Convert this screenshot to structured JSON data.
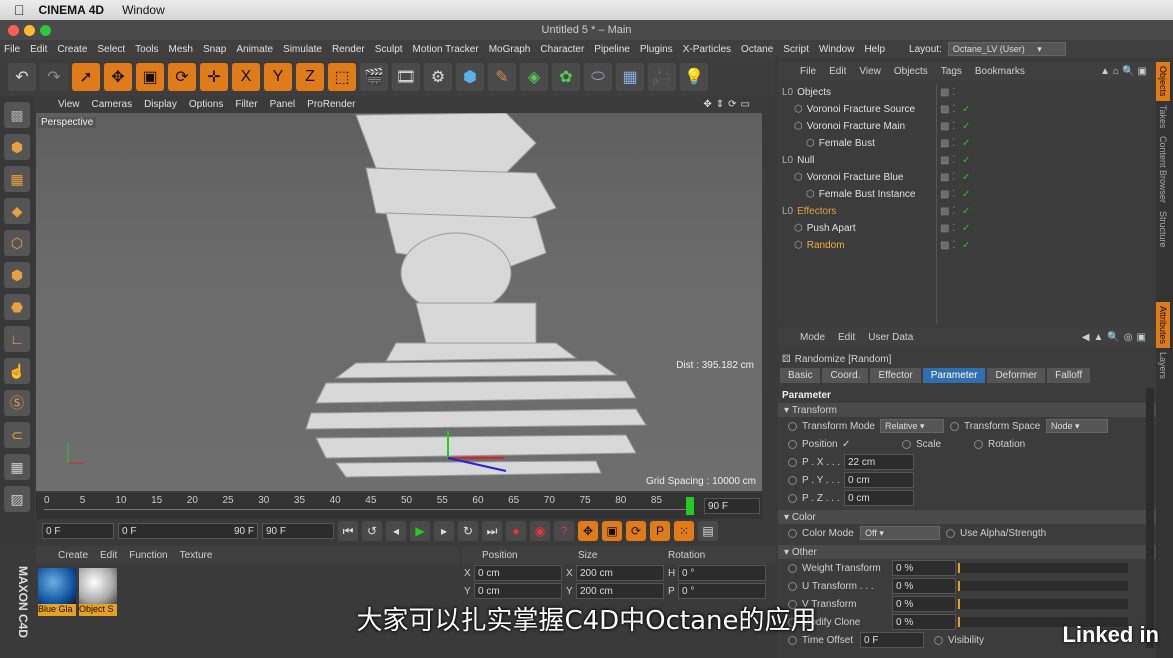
{
  "mac_menu": {
    "app": "CINEMA 4D",
    "window": "Window"
  },
  "window_title": "Untitled 5 * – Main",
  "main_menu": [
    "File",
    "Edit",
    "Create",
    "Select",
    "Tools",
    "Mesh",
    "Snap",
    "Animate",
    "Simulate",
    "Render",
    "Sculpt",
    "Motion Tracker",
    "MoGraph",
    "Character",
    "Pipeline",
    "Plugins",
    "X-Particles",
    "Octane",
    "Script",
    "Window",
    "Help"
  ],
  "layout": {
    "label": "Layout:",
    "value": "Octane_LV (User)"
  },
  "toolbar_axes": [
    "X",
    "Y",
    "Z"
  ],
  "viewport": {
    "menu": [
      "View",
      "Cameras",
      "Display",
      "Options",
      "Filter",
      "Panel",
      "ProRender"
    ],
    "name": "Perspective",
    "dist": "Dist : 395.182 cm",
    "grid": "Grid Spacing : 10000 cm"
  },
  "timeline": {
    "ticks": [
      "0",
      "5",
      "10",
      "15",
      "20",
      "25",
      "30",
      "35",
      "40",
      "45",
      "50",
      "55",
      "60",
      "65",
      "70",
      "75",
      "80",
      "85"
    ],
    "end_frame": "90 F"
  },
  "transport": {
    "start": "0 F",
    "min": "0 F",
    "max": "90 F",
    "end": "90 F"
  },
  "material_panel": {
    "menu": [
      "Create",
      "Edit",
      "Function",
      "Texture"
    ],
    "materials": [
      "Blue Gla",
      "Object S"
    ]
  },
  "coord_panel": {
    "headers": [
      "Position",
      "Size",
      "Rotation"
    ],
    "rows": [
      {
        "a": "X",
        "pos": "0 cm",
        "s": "X",
        "size": "200 cm",
        "r": "H",
        "rot": "0 °"
      },
      {
        "a": "Y",
        "pos": "0 cm",
        "s": "Y",
        "size": "200 cm",
        "r": "P",
        "rot": "0 °"
      }
    ]
  },
  "object_manager": {
    "menu": [
      "File",
      "Edit",
      "View",
      "Objects",
      "Tags",
      "Bookmarks"
    ],
    "objects": [
      {
        "name": "Objects",
        "indent": 0,
        "color": "#e0e0e0"
      },
      {
        "name": "Voronoi Fracture Source",
        "indent": 1,
        "color": "#e0e0e0"
      },
      {
        "name": "Voronoi Fracture Main",
        "indent": 1,
        "color": "#e0e0e0"
      },
      {
        "name": "Female Bust",
        "indent": 2,
        "color": "#e0e0e0"
      },
      {
        "name": "Null",
        "indent": 0,
        "color": "#e0e0e0"
      },
      {
        "name": "Voronoi Fracture Blue",
        "indent": 1,
        "color": "#e0e0e0"
      },
      {
        "name": "Female Bust Instance",
        "indent": 2,
        "color": "#e0e0e0"
      },
      {
        "name": "Effectors",
        "indent": 0,
        "color": "#e8a040"
      },
      {
        "name": "Push Apart",
        "indent": 1,
        "color": "#e0e0e0"
      },
      {
        "name": "Random",
        "indent": 1,
        "color": "#f0b040"
      }
    ]
  },
  "attributes": {
    "menu": [
      "Mode",
      "Edit",
      "User Data"
    ],
    "object_title": "Randomize [Random]",
    "tabs": [
      "Basic",
      "Coord.",
      "Effector",
      "Parameter",
      "Deformer",
      "Falloff"
    ],
    "active_tab": "Parameter",
    "section": "Parameter",
    "transform_header": "Transform",
    "transform_mode_label": "Transform Mode",
    "transform_mode": "Relative",
    "transform_space_label": "Transform Space",
    "transform_space": "Node",
    "position_label": "Position",
    "scale_label": "Scale",
    "rotation_label": "Rotation",
    "px_label": "P . X . . .",
    "px": "22 cm",
    "py_label": "P . Y . . .",
    "py": "0 cm",
    "pz_label": "P . Z . . .",
    "pz": "0 cm",
    "color_header": "Color",
    "color_mode_label": "Color Mode",
    "color_mode": "Off",
    "use_alpha_label": "Use Alpha/Strength",
    "other_header": "Other",
    "other_rows": [
      {
        "label": "Weight Transform",
        "value": "0 %"
      },
      {
        "label": "U Transform . . .",
        "value": "0 %"
      },
      {
        "label": "V Transform",
        "value": "0 %"
      },
      {
        "label": "Modify Clone",
        "value": "0 %"
      }
    ],
    "time_offset_label": "Time Offset",
    "time_offset": "0 F",
    "visibility_label": "Visibility"
  },
  "side_tabs": [
    "Objects",
    "Takes",
    "Content Browser",
    "Structure",
    "Attributes",
    "Layers"
  ],
  "subtitle": "大家可以扎实掌握C4D中Octane的应用",
  "watermark": "Linked in",
  "colors": {
    "accent_orange": "#e07b1a",
    "accent_blue": "#2f6fb0"
  }
}
